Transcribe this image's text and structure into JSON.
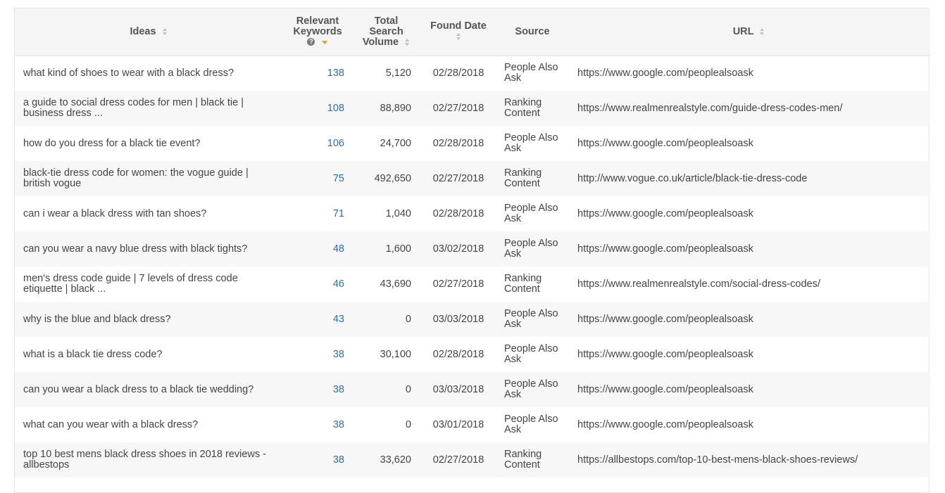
{
  "headers": {
    "ideas": "Ideas",
    "keywords_line1": "Relevant",
    "keywords_line2": "Keywords",
    "volume_line1": "Total",
    "volume_line2": "Search",
    "volume_line3": "Volume",
    "date": "Found Date",
    "source_line1": "Source",
    "url": "URL"
  },
  "colors": {
    "accent": "#2e6db4",
    "sort_active": "#f0a020",
    "sort_inactive": "#c0c0c0"
  },
  "rows": [
    {
      "idea": "what kind of shoes to wear with a black dress?",
      "kw": "138",
      "vol": "5,120",
      "date": "02/28/2018",
      "src1": "People Also",
      "src2": "Ask",
      "url": "https://www.google.com/peoplealsoask"
    },
    {
      "idea": "a guide to social dress codes for men | black tie | business dress ...",
      "kw": "108",
      "vol": "88,890",
      "date": "02/27/2018",
      "src1": "Ranking",
      "src2": "Content",
      "url": "https://www.realmenrealstyle.com/guide-dress-codes-men/"
    },
    {
      "idea": "how do you dress for a black tie event?",
      "kw": "106",
      "vol": "24,700",
      "date": "02/28/2018",
      "src1": "People Also",
      "src2": "Ask",
      "url": "https://www.google.com/peoplealsoask"
    },
    {
      "idea": "black-tie dress code for women: the vogue guide | british vogue",
      "kw": "75",
      "vol": "492,650",
      "date": "02/27/2018",
      "src1": "Ranking",
      "src2": "Content",
      "url": "http://www.vogue.co.uk/article/black-tie-dress-code"
    },
    {
      "idea": "can i wear a black dress with tan shoes?",
      "kw": "71",
      "vol": "1,040",
      "date": "02/28/2018",
      "src1": "People Also",
      "src2": "Ask",
      "url": "https://www.google.com/peoplealsoask"
    },
    {
      "idea": "can you wear a navy blue dress with black tights?",
      "kw": "48",
      "vol": "1,600",
      "date": "03/02/2018",
      "src1": "People Also",
      "src2": "Ask",
      "url": "https://www.google.com/peoplealsoask"
    },
    {
      "idea": "men's dress code guide | 7 levels of dress code etiquette | black ...",
      "kw": "46",
      "vol": "43,690",
      "date": "02/27/2018",
      "src1": "Ranking",
      "src2": "Content",
      "url": "https://www.realmenrealstyle.com/social-dress-codes/"
    },
    {
      "idea": "why is the blue and black dress?",
      "kw": "43",
      "vol": "0",
      "date": "03/03/2018",
      "src1": "People Also",
      "src2": "Ask",
      "url": "https://www.google.com/peoplealsoask"
    },
    {
      "idea": "what is a black tie dress code?",
      "kw": "38",
      "vol": "30,100",
      "date": "02/28/2018",
      "src1": "People Also",
      "src2": "Ask",
      "url": "https://www.google.com/peoplealsoask"
    },
    {
      "idea": "can you wear a black dress to a black tie wedding?",
      "kw": "38",
      "vol": "0",
      "date": "03/03/2018",
      "src1": "People Also",
      "src2": "Ask",
      "url": "https://www.google.com/peoplealsoask"
    },
    {
      "idea": "what can you wear with a black dress?",
      "kw": "38",
      "vol": "0",
      "date": "03/01/2018",
      "src1": "People Also",
      "src2": "Ask",
      "url": "https://www.google.com/peoplealsoask"
    },
    {
      "idea": "top 10 best mens black dress shoes in 2018 reviews - allbestops",
      "kw": "38",
      "vol": "33,620",
      "date": "02/27/2018",
      "src1": "Ranking",
      "src2": "Content",
      "url": "https://allbestops.com/top-10-best-mens-black-shoes-reviews/"
    }
  ]
}
